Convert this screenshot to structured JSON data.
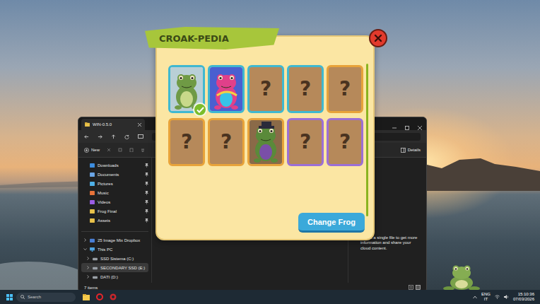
{
  "explorer": {
    "tab_title": "WIN-0.5.0",
    "new_button": "New",
    "details_button": "Details",
    "sidebar": [
      {
        "label": "Downloads",
        "pinned": true,
        "color": "#3d8ee0"
      },
      {
        "label": "Documents",
        "pinned": true,
        "color": "#6aa5e6"
      },
      {
        "label": "Pictures",
        "pinned": true,
        "color": "#4fb0e8"
      },
      {
        "label": "Music",
        "pinned": true,
        "color": "#e8733a"
      },
      {
        "label": "Videos",
        "pinned": true,
        "color": "#9b5de5"
      },
      {
        "label": "Frog Final",
        "pinned": true,
        "color": "#e8c14a"
      },
      {
        "label": "Assets",
        "pinned": true,
        "color": "#e8c14a"
      }
    ],
    "drives": [
      {
        "label": "25 Image Mix Dropbox",
        "kind": "cloud",
        "expanded": false,
        "selected": false
      },
      {
        "label": "This PC",
        "kind": "pc",
        "expanded": true,
        "selected": false
      },
      {
        "label": "SSD Sistema (C:)",
        "kind": "drive",
        "expanded": false,
        "selected": false
      },
      {
        "label": "SECONDARY SSD (E:)",
        "kind": "drive",
        "expanded": false,
        "selected": true
      },
      {
        "label": "DATI (D:)",
        "kind": "drive",
        "expanded": false,
        "selected": false
      }
    ],
    "details_message": "Select a single file to get more information and share your cloud content.",
    "status": "7 items"
  },
  "popup": {
    "title": "CROAK-PEDIA",
    "cards": [
      {
        "kind": "frog",
        "selected": true,
        "color": "#3fb8d0"
      },
      {
        "kind": "frog",
        "selected": false,
        "color": "#3fb8d0"
      },
      {
        "kind": "unknown",
        "label": "?",
        "selected": false,
        "color": "#3fb8d0"
      },
      {
        "kind": "unknown",
        "label": "?",
        "selected": false,
        "color": "#3fb8d0"
      },
      {
        "kind": "unknown",
        "label": "?",
        "selected": false,
        "color": "#e8a33a"
      },
      {
        "kind": "unknown",
        "label": "?",
        "selected": false,
        "color": "#e8a33a"
      },
      {
        "kind": "unknown",
        "label": "?",
        "selected": false,
        "color": "#e8a33a"
      },
      {
        "kind": "frog",
        "selected": false,
        "color": "#e8a33a"
      },
      {
        "kind": "unknown",
        "label": "?",
        "selected": false,
        "color": "#9b6fd6"
      },
      {
        "kind": "unknown",
        "label": "?",
        "selected": false,
        "color": "#9b6fd6"
      }
    ],
    "button": "Change Frog"
  },
  "taskbar": {
    "search_placeholder": "Search",
    "language": "ENG",
    "region": "IT",
    "time": "15:10:36",
    "date": "07/03/2026"
  }
}
